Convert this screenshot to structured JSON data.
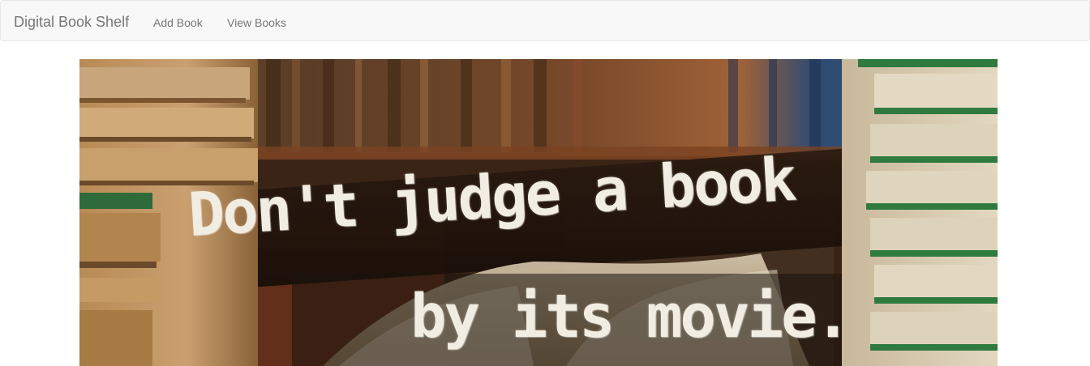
{
  "navbar": {
    "brand": "Digital Book Shelf",
    "links": [
      {
        "label": "Add Book"
      },
      {
        "label": "View Books"
      }
    ]
  },
  "hero": {
    "quote_line1": "Don't judge a book",
    "quote_line2": "by its movie."
  },
  "colors": {
    "navbar_bg": "#f8f8f8",
    "navbar_border": "#e7e7e7",
    "nav_text": "#777777"
  }
}
